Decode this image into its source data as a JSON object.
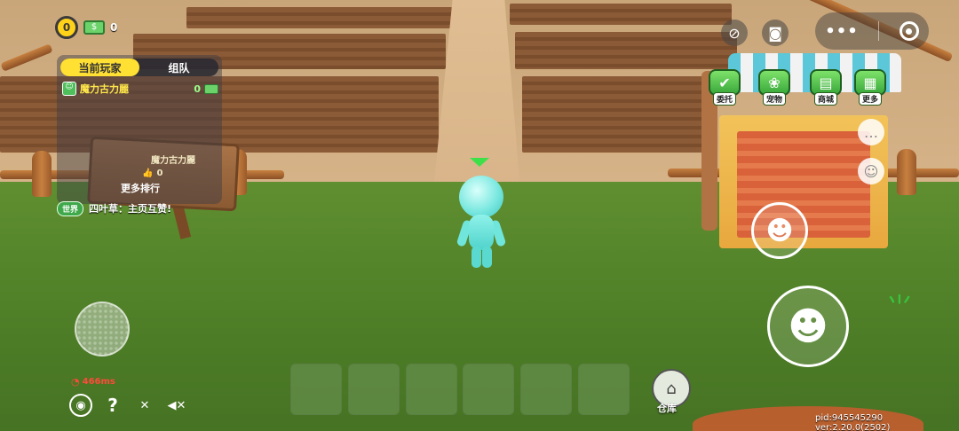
{
  "hud": {
    "coins": "0",
    "cash": "0",
    "ping": "466ms",
    "version": "pid:945545290 ver:2.20.0(2502)"
  },
  "leaderboard": {
    "tabs": [
      {
        "label": "当前玩家",
        "active": true
      },
      {
        "label": "组队",
        "active": false
      }
    ],
    "rows": [
      {
        "name": "魔力古力麗",
        "value": "0"
      }
    ],
    "more_label": "更多排行"
  },
  "sign": {
    "name": "魔力古力麗",
    "likes": "0"
  },
  "chat": {
    "channel": "世界",
    "message": "四叶草：主页互赞!"
  },
  "menu": [
    {
      "label": "委托",
      "icon": "clipboard-icon"
    },
    {
      "label": "宠物",
      "icon": "paw-icon"
    },
    {
      "label": "商城",
      "icon": "cart-icon"
    },
    {
      "label": "更多",
      "icon": "grid-icon"
    }
  ],
  "storage": {
    "label": "仓库"
  },
  "colors": {
    "accent_yellow": "#ffe033",
    "menu_green": "#38a83b",
    "ping_red": "#ff4a3a"
  }
}
